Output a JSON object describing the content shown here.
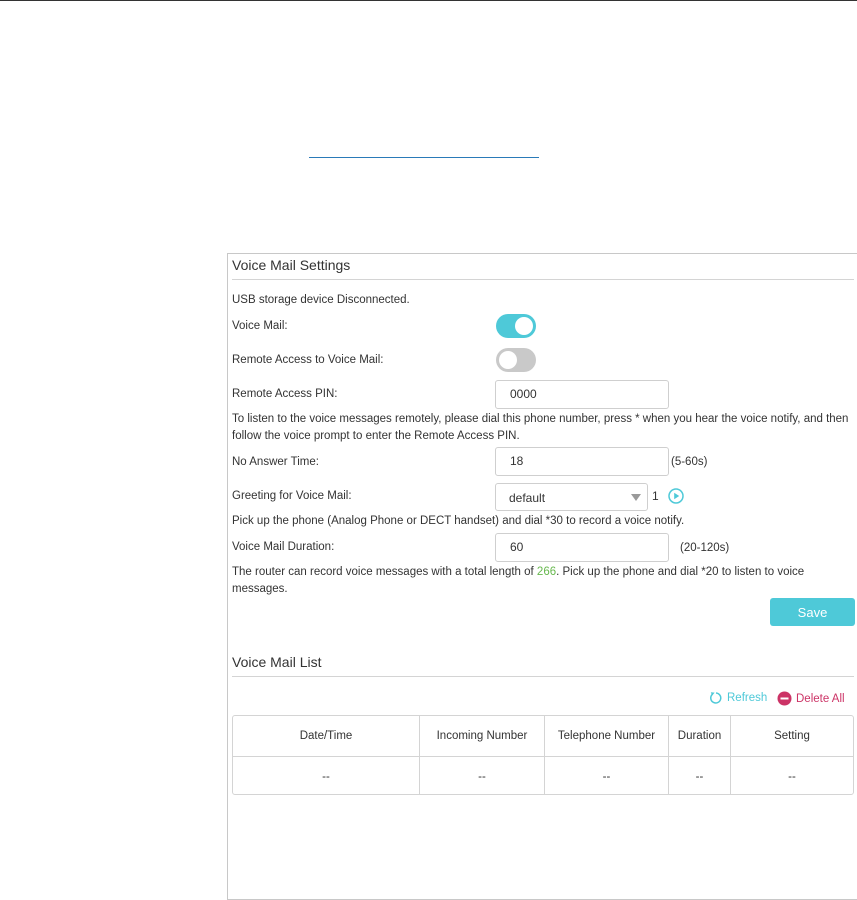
{
  "settings": {
    "title": "Voice Mail Settings",
    "usb_status": "USB storage device Disconnected.",
    "voice_mail_label": "Voice Mail:",
    "voice_mail_enabled": true,
    "remote_access_label": "Remote Access to Voice Mail:",
    "remote_access_enabled": false,
    "pin_label": "Remote Access PIN:",
    "pin_value": "0000",
    "remote_info": "To listen to the voice messages remotely, please dial this phone number, press * when you hear the voice notify, and then follow the voice prompt to enter the Remote Access PIN.",
    "no_answer_label": "No Answer Time:",
    "no_answer_value": "18",
    "no_answer_hint": "(5-60s)",
    "greeting_label": "Greeting for Voice Mail:",
    "greeting_value": "default",
    "greeting_number": "1",
    "greeting_info": "Pick up the phone (Analog Phone or DECT handset) and dial *30 to record a voice notify.",
    "duration_label": "Voice Mail Duration:",
    "duration_value": "60",
    "duration_hint": "(20-120s)",
    "record_info_pre": "The router can record voice messages with a total length of ",
    "record_total": "266",
    "record_info_post": ". Pick up the phone and dial *20 to listen to voice messages.",
    "save_label": "Save"
  },
  "list": {
    "title": "Voice Mail List",
    "refresh_label": "Refresh",
    "delete_all_label": "Delete All",
    "columns": [
      "Date/Time",
      "Incoming Number",
      "Telephone Number",
      "Duration",
      "Setting"
    ],
    "rows": [
      [
        "--",
        "--",
        "--",
        "--",
        "--"
      ]
    ]
  },
  "colors": {
    "accent": "#4ec9d8",
    "delete": "#cc3366",
    "highlight": "#67b84e"
  }
}
